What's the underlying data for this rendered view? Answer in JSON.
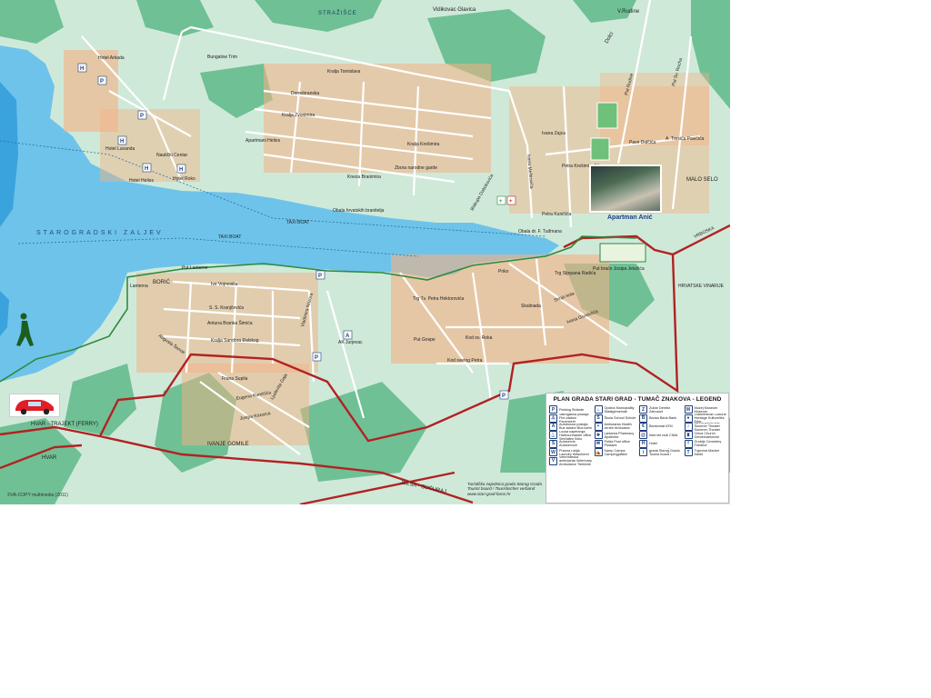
{
  "map": {
    "bay_name": "STAROGRADSKI  ZALJEV",
    "boat_labels": [
      "TAXI BOAT",
      "TAXI BOAT"
    ],
    "places": [
      "STRAŽIŠĆE",
      "Vidikovac Glavica",
      "V.Rudine",
      "Dolci",
      "MALO SELO",
      "BORIĆ",
      "IVANJE GOMILE",
      "Lanterna",
      "HRVATSKE VINARIJE",
      "VRBOSKA",
      "HVAR",
      "JELSA - SUĆURAJ",
      "HVAR - TRAJEKT (FERRY)"
    ],
    "buildings": [
      "Hotel Arkada",
      "Bungalow Trim",
      "Apartmani Helios",
      "Hotel Lavanda",
      "Hotel Helios",
      "Hotel Roko",
      "Nautički Centar",
      "AK Jurjevac",
      "Apartman Anić"
    ],
    "streets": [
      "Kralja Tomislava",
      "Domobranska",
      "Kralja Zvonimira",
      "Put Rudine",
      "Put Sv. Rocha",
      "Ivana Zajca",
      "Kralja Krešimira",
      "Zbora narodne garde",
      "Kneza Branimira",
      "Obala hrvatskih branitelja",
      "Obala dr. F. Tuđmana",
      "Put Lanterne",
      "Ive Vojnovića",
      "S. S. Kranjčevića",
      "Antuna Branka Šimića",
      "Kralja Sandora Đalskog",
      "Augusta Šenoe",
      "Vladimira Nazora",
      "Trg Tv. Petra Hektorovića",
      "Put Gospe",
      "Frana Supila",
      "Eugena Kumičića",
      "Josipa Kozarca",
      "Ljudevita Gaja",
      "Trg Stjepana Radića",
      "Put braće Josipa Jelačića",
      "Kod sv. Roka",
      "Kod svetog Petra",
      "Priko",
      "Skalinada",
      "Srinjo kola",
      "Ivana Gundulića",
      "Ivana Meštrovića",
      "Petra Krešimira IV",
      "Petra Kuničića",
      "Pave Dulčića",
      "A. Tresića Pavičića",
      "Biskupa Dubokovića"
    ],
    "photo_label": "Apartman Anić",
    "credits": "©VA-COPY multimedia (2011)",
    "tourist_board": [
      "Turistička zajednica grada Starog Grada",
      "Tourist board / Touristischer verband",
      "www.stari-grad-faros.hr"
    ]
  },
  "legend": {
    "title": "PLAN GRADA STARI GRAD - TUMAČ ZNAKOVA - LEGEND",
    "items": [
      {
        "sym": "P",
        "label": "Parking Strände"
      },
      {
        "sym": "⌂",
        "label": "Općina Municipality Stadtgemeinde"
      },
      {
        "sym": "Z",
        "label": "Zubar Dentist Zahnarzt"
      },
      {
        "sym": "M",
        "label": "Muzej Museum Museum"
      },
      {
        "sym": "⚠",
        "label": "Vatrogasna postaja Fire-station Feuerwehr"
      },
      {
        "sym": "Š",
        "label": "Škola School Schule"
      },
      {
        "sym": "B",
        "label": "Banka Bank Bank"
      },
      {
        "sym": "●",
        "label": "Znamenitost Cultural Heritage Kulturelles Erbe"
      },
      {
        "sym": "A",
        "label": "Autobusna postaja Bus station Bus bahn"
      },
      {
        "sym": "+",
        "label": "Ambulanta Health centre Ambulanz"
      },
      {
        "sym": "€",
        "label": "Bankomat ATM"
      },
      {
        "sym": "♪",
        "label": "Ljetna pozornica Summer Theater Sommer-Theater"
      },
      {
        "sym": "⚓",
        "label": "Lučka kapetanija Harbourmaster office Seehafen Büro"
      },
      {
        "sym": "✚",
        "label": "Ljekarna Pharmacy Apotheke"
      },
      {
        "sym": "@",
        "label": "Internet club CIMA"
      },
      {
        "sym": "♜",
        "label": "Crkva Church Gemeindekirche"
      },
      {
        "sym": "S",
        "label": "Autoservis Autoservice"
      },
      {
        "sym": "✉",
        "label": "Pošta Post office Postamt"
      },
      {
        "sym": "H",
        "label": "Hotel"
      },
      {
        "sym": "†",
        "label": "Groblje Cemetery Friedhof"
      },
      {
        "sym": "W",
        "label": "Praona rublja Laundry Wäscherei"
      },
      {
        "sym": "⛺",
        "label": "Kamp Camps Campingplätze"
      },
      {
        "sym": "i",
        "label": "Turistička zajednica grada Starog Grada Tourist board / Touristischer verband"
      },
      {
        "sym": "T",
        "label": "Trgovina Market Markt"
      },
      {
        "sym": "V",
        "label": "Veterinarska ambulanta Veterinary Ambulance Tierklinik"
      }
    ]
  },
  "colors": {
    "sea": "#6ec3ea",
    "sea_deep": "#3aa3dd",
    "land": "#cfe9d9",
    "hills": "#5fb98a",
    "buildings": "#f4b183",
    "main_road": "#b22222",
    "coast_path": "#2e8b3e"
  }
}
